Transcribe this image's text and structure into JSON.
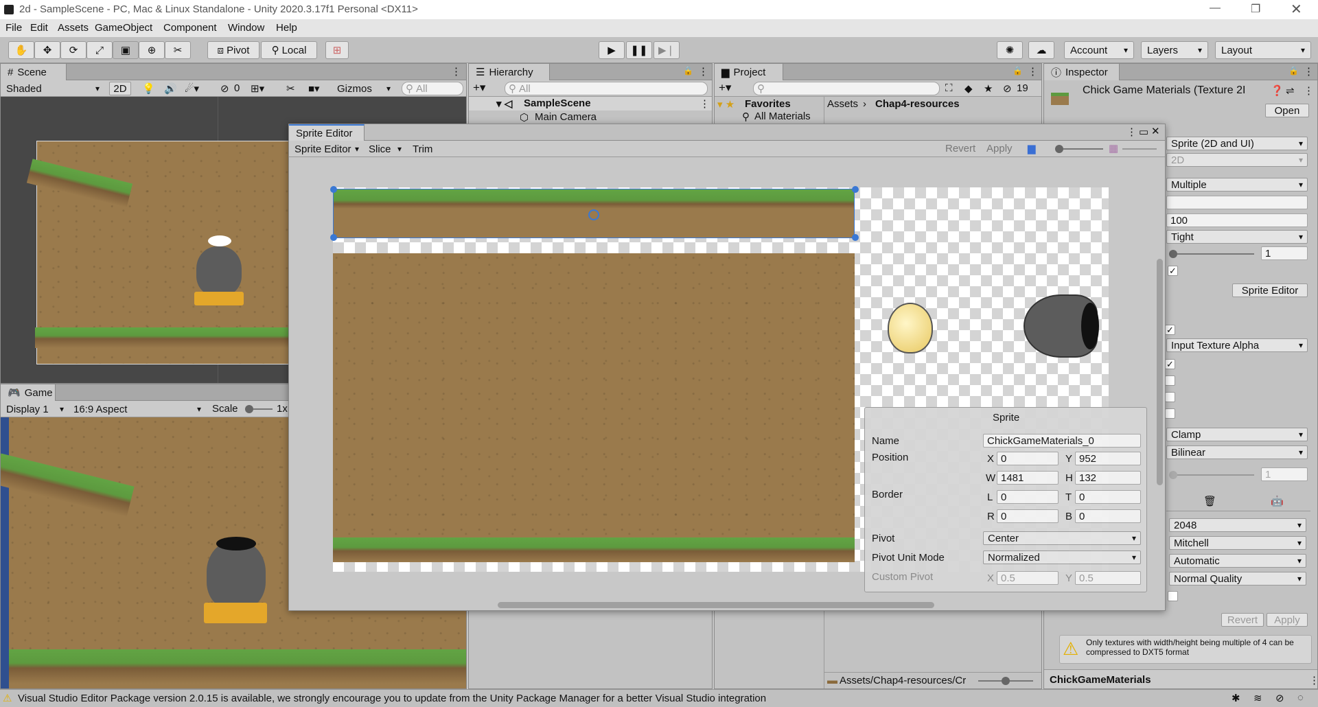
{
  "window": {
    "title": "2d - SampleScene - PC, Mac & Linux Standalone - Unity 2020.3.17f1 Personal <DX11>"
  },
  "menu": [
    "File",
    "Edit",
    "Assets",
    "GameObject",
    "Component",
    "Window",
    "Help"
  ],
  "toolbar": {
    "pivot": "Pivot",
    "local": "Local",
    "account": "Account",
    "layers": "Layers",
    "layout": "Layout"
  },
  "scene": {
    "tab": "Scene",
    "shading": "Shaded",
    "mode_2d": "2D",
    "hidden_count": "0",
    "gizmos": "Gizmos",
    "search_placeholder": "All"
  },
  "game": {
    "tab": "Game",
    "display": "Display 1",
    "aspect": "16:9 Aspect",
    "scale_label": "Scale",
    "scale_value": "1x"
  },
  "hierarchy": {
    "tab": "Hierarchy",
    "search_placeholder": "All",
    "items": [
      "SampleScene",
      "Main Camera"
    ]
  },
  "project": {
    "tab": "Project",
    "favorites": "Favorites",
    "all_materials": "All Materials",
    "breadcrumb": [
      "Assets",
      "Chap4-resources"
    ],
    "hidden_count": "19",
    "path": "Assets/Chap4-resources/Cr"
  },
  "sprite_editor": {
    "tab": "Sprite Editor",
    "menu_label": "Sprite Editor",
    "slice": "Slice",
    "trim": "Trim",
    "revert": "Revert",
    "apply": "Apply"
  },
  "sprite_panel": {
    "title": "Sprite",
    "name_label": "Name",
    "name_value": "ChickGameMaterials_0",
    "position_label": "Position",
    "x_label": "X",
    "x": "0",
    "y_label": "Y",
    "y": "952",
    "w_label": "W",
    "w": "1481",
    "h_label": "H",
    "h": "132",
    "border_label": "Border",
    "l_label": "L",
    "l": "0",
    "t_label": "T",
    "t": "0",
    "r_label": "R",
    "r": "0",
    "b_label": "B",
    "b": "0",
    "pivot_label": "Pivot",
    "pivot_value": "Center",
    "pivot_unit_label": "Pivot Unit Mode",
    "pivot_unit_value": "Normalized",
    "custom_pivot_label": "Custom Pivot",
    "cp_x": "0.5",
    "cp_y": "0.5"
  },
  "inspector": {
    "tab": "Inspector",
    "asset_title": "Chick Game Materials (Texture 2I",
    "open": "Open",
    "texture_type": "Sprite (2D and UI)",
    "texture_shape": "2D",
    "sprite_mode": "Multiple",
    "ppu": "100",
    "mesh_type": "Tight",
    "extrude": "1",
    "sprite_editor_button": "Sprite Editor",
    "alpha_source": "Input Texture Alpha",
    "wrap_mode": "Clamp",
    "filter_mode": "Bilinear",
    "aniso": "1",
    "max_size": "2048",
    "resize": "Mitchell",
    "format": "Automatic",
    "compression": "Normal Quality",
    "revert": "Revert",
    "apply": "Apply",
    "warning": "Only textures with width/height being multiple of 4 can be compressed to DXT5 format",
    "footer": "ChickGameMaterials"
  },
  "status": {
    "message": "Visual Studio Editor Package version 2.0.15 is available, we strongly encourage you to update from the Unity Package Manager for a better Visual Studio integration"
  },
  "icons": [
    "unity-logo-icon",
    "hand-tool-icon",
    "move-tool-icon",
    "rotate-tool-icon",
    "scale-tool-icon",
    "rect-tool-icon",
    "transform-tool-icon",
    "custom-tool-icon",
    "play-icon",
    "pause-icon",
    "step-icon",
    "cloud-icon",
    "collab-icon",
    "warning-icon",
    "lock-icon",
    "kebab-menu-icon"
  ]
}
